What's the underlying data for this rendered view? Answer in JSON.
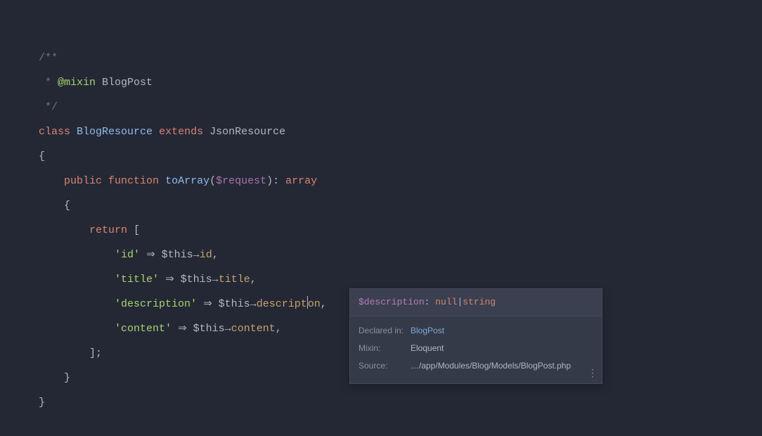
{
  "code": {
    "docblock_open": "/**",
    "docblock_star": " * ",
    "at_mixin": "@mixin",
    "mixin_type": "BlogPost",
    "docblock_close": " */",
    "kw_class": "class",
    "class_name": "BlogResource",
    "kw_extends": "extends",
    "parent_class": "JsonResource",
    "brace_open": "{",
    "kw_public": "public",
    "kw_function": "function",
    "method_name": "toArray",
    "paren_open": "(",
    "param_var": "$request",
    "paren_close": ")",
    "colon": ":",
    "return_type": "array",
    "kw_return": "return",
    "bracket_open": "[",
    "key_id": "'id'",
    "key_title": "'title'",
    "key_description": "'description'",
    "key_content": "'content'",
    "arrow_fat": "⇒",
    "this": "$this",
    "arrow_thin": "→",
    "prop_id": "id",
    "prop_title": "title",
    "prop_description_1": "descript",
    "prop_description_2": "on",
    "prop_content": "content",
    "comma": ",",
    "bracket_close_semi": "];",
    "brace_close": "}"
  },
  "tooltip": {
    "var": "$description",
    "colon": ": ",
    "null": "null",
    "pipe": "|",
    "type": "string",
    "declared_label": "Declared in:",
    "declared_value": "BlogPost",
    "mixin_label": "Mixin:",
    "mixin_value": "Eloquent",
    "source_label": "Source:",
    "source_value": "…/app/Modules/Blog/Models/BlogPost.php",
    "more": "⋮"
  }
}
